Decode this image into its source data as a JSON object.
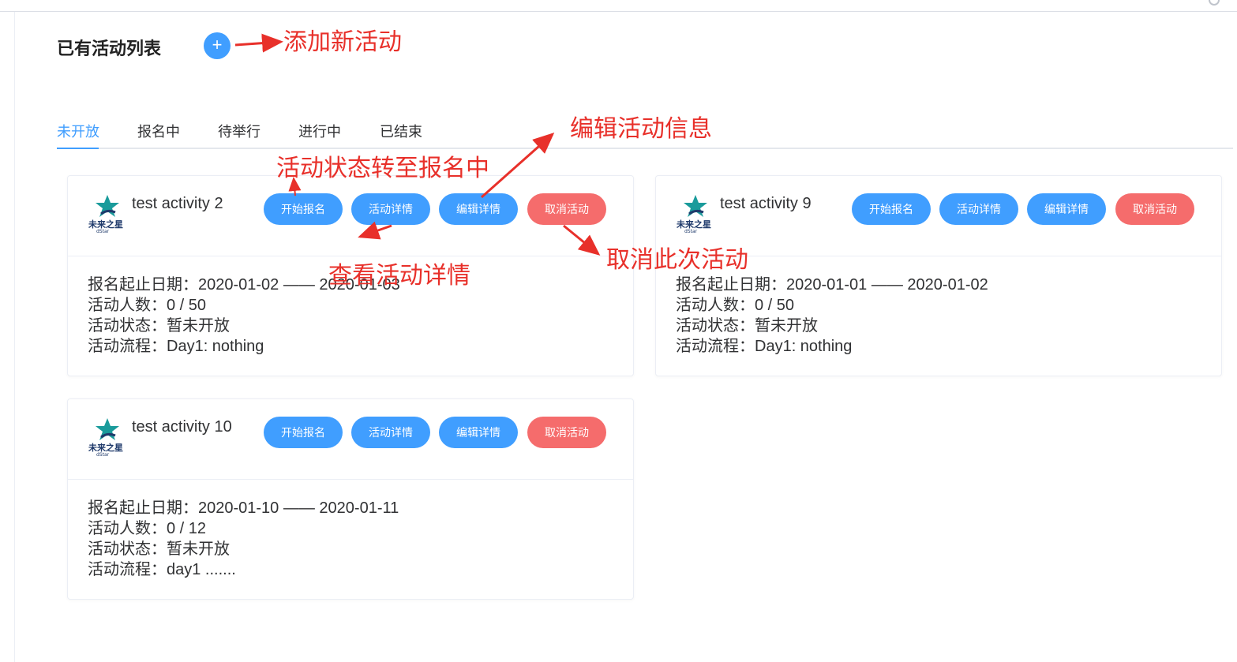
{
  "header": {
    "title": "已有活动列表",
    "add_icon": "+"
  },
  "tabs": [
    {
      "label": "未开放",
      "active": true
    },
    {
      "label": "报名中",
      "active": false
    },
    {
      "label": "待举行",
      "active": false
    },
    {
      "label": "进行中",
      "active": false
    },
    {
      "label": "已结束",
      "active": false
    }
  ],
  "buttons": {
    "start": "开始报名",
    "details": "活动详情",
    "edit": "编辑详情",
    "cancel": "取消活动"
  },
  "activities": [
    {
      "name": "test activity 2",
      "date_line": "报名起止日期：2020-01-02 —— 2020-01-03",
      "people_line": "活动人数：0 / 50",
      "status_line": "活动状态：暂未开放",
      "flow_line": "活动流程：Day1: nothing"
    },
    {
      "name": "test activity 9",
      "date_line": "报名起止日期：2020-01-01 —— 2020-01-02",
      "people_line": "活动人数：0 / 50",
      "status_line": "活动状态：暂未开放",
      "flow_line": "活动流程：Day1: nothing"
    },
    {
      "name": "test activity 10",
      "date_line": "报名起止日期：2020-01-10 —— 2020-01-11",
      "people_line": "活动人数：0 / 12",
      "status_line": "活动状态：暂未开放",
      "flow_line": "活动流程：day1 ......."
    }
  ],
  "logo": {
    "text": "未来之星",
    "subtext": "dStar"
  },
  "annotations": {
    "add_new": "添加新活动",
    "edit_info": "编辑活动信息",
    "to_registration": "活动状态转至报名中",
    "view_details": "查看活动详情",
    "cancel_this": "取消此次活动"
  },
  "colors": {
    "primary": "#409eff",
    "danger": "#f56c6c",
    "annotation": "#e8302a",
    "logo_teal": "#1a9b9b",
    "logo_navy": "#1f3a6b"
  }
}
